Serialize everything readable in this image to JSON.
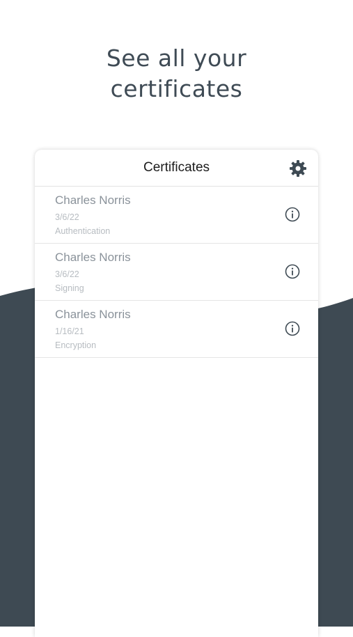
{
  "headline": {
    "line1": "See all your",
    "line2": "certificates"
  },
  "colors": {
    "background_wave": "#3e4a53",
    "headline_text": "#3f4b55",
    "card_background": "#ffffff",
    "name_text": "#8a929a",
    "meta_text": "#b7bcc1",
    "icon": "#3e4a53"
  },
  "card": {
    "title": "Certificates",
    "settings_icon": "gear-icon"
  },
  "certificates": [
    {
      "name": "Charles Norris",
      "date": "3/6/22",
      "type": "Authentication",
      "icon": "info-icon"
    },
    {
      "name": "Charles Norris",
      "date": "3/6/22",
      "type": "Signing",
      "icon": "info-icon"
    },
    {
      "name": "Charles Norris",
      "date": "1/16/21",
      "type": "Encryption",
      "icon": "info-icon"
    }
  ]
}
